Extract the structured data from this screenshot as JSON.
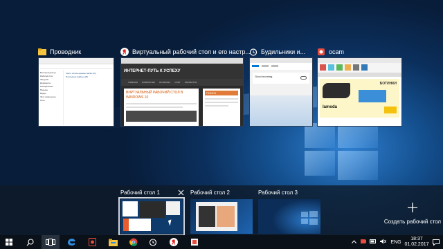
{
  "windows": [
    {
      "title": "Проводник",
      "icon": "folder-icon"
    },
    {
      "title": "Виртуальный рабочий стол и его настр...",
      "icon": "yandex-browser-icon"
    },
    {
      "title": "Будильники и...",
      "icon": "alarm-clock-icon"
    },
    {
      "title": "ocam",
      "icon": "ocam-icon"
    }
  ],
  "explorer_thumb": {
    "items": [
      "Быстрый доступ",
      "Рабочий стол",
      "Загрузки",
      "Документы",
      "Изображения",
      "Музыка",
      "Видео",
      "Этот компьютер",
      "Сеть"
    ],
    "files": [
      "Часто используемые папки (11)",
      "Последние файлы (20)"
    ]
  },
  "browser_thumb": {
    "site_title": "ИНТЕРНЕТ-ПУТЬ К УСПЕХУ",
    "menu": [
      "ГЛАВНАЯ",
      "КОМПЬЮТЕР",
      "ИНТЕРНЕТ",
      "СОФТ",
      "ЗАРАБОТОК"
    ],
    "headline": "ВИРТУАЛЬНЫЙ РАБОЧИЙ СТОЛ В WINDOWS 10",
    "side_head": "ПОИСК"
  },
  "alarm_thumb": {
    "alarm_name": "Good morning"
  },
  "ocam_thumb": {
    "ad_word": "БОТИНКИ",
    "brand": "lamoda"
  },
  "desktops": [
    {
      "label": "Рабочий стол 1",
      "selected": true
    },
    {
      "label": "Рабочий стол 2",
      "selected": false
    },
    {
      "label": "Рабочий стол 3",
      "selected": false
    }
  ],
  "new_desktop": {
    "label": "Создать рабочий стол",
    "icon": "plus-icon"
  },
  "close_desktop_icon": "close-icon",
  "taskbar": {
    "apps": [
      "start-icon",
      "search-icon",
      "task-view-icon",
      "edge-icon",
      "ocam-icon",
      "explorer-icon",
      "chrome-icon",
      "alarm-clock-icon",
      "yandex-browser-icon",
      "paint-icon"
    ],
    "language": "ENG",
    "time": "18:37",
    "date": "01.02.2017"
  }
}
